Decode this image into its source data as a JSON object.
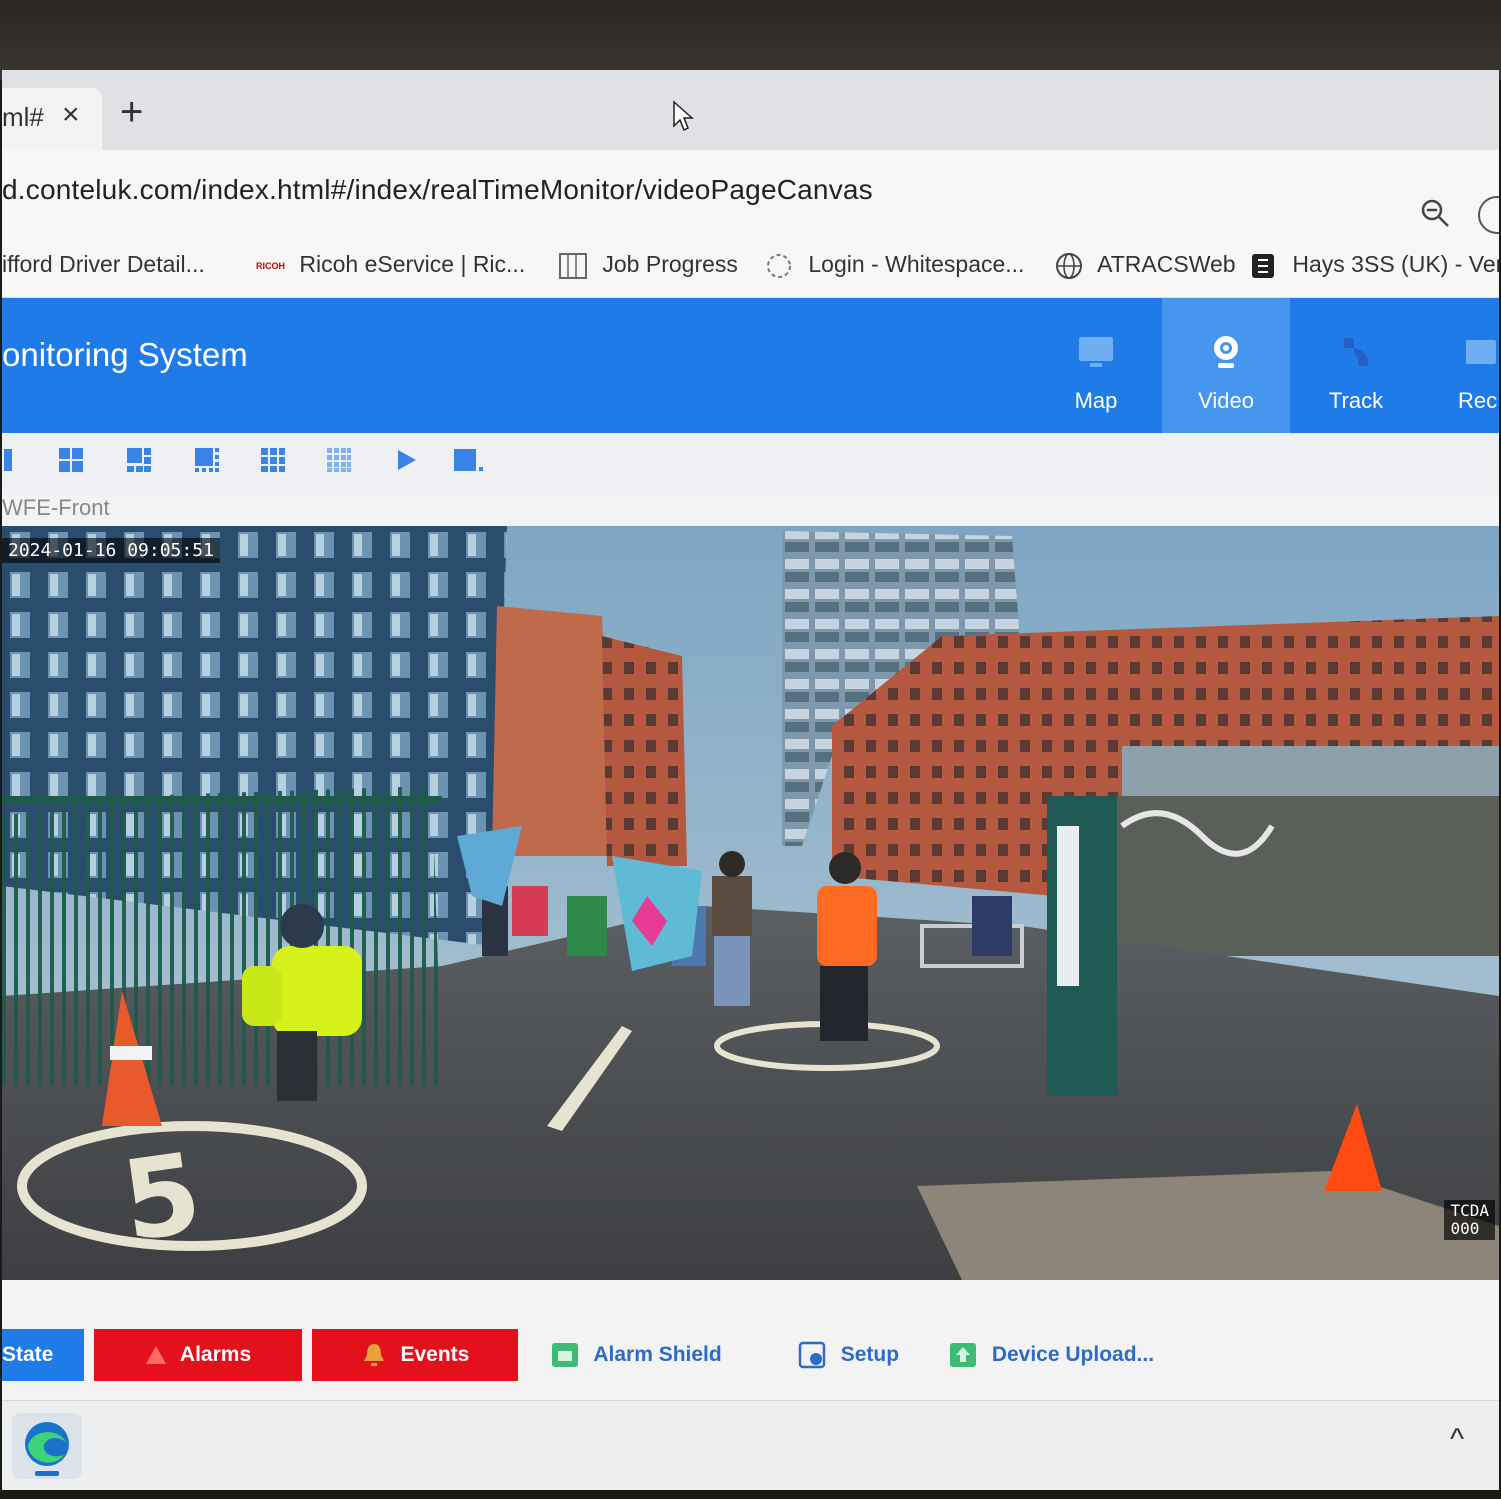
{
  "browser": {
    "tab_title": "ml#",
    "tab_close": "×",
    "new_tab": "+",
    "url": "d.conteluk.com/index.html#/index/realTimeMonitor/videoPageCanvas"
  },
  "bookmarks": [
    {
      "label": "ifford Driver Detail...",
      "icon": "none"
    },
    {
      "label": "Ricoh eService | Ric...",
      "icon": "ricoh-logo-icon",
      "logo_text": "RICOH"
    },
    {
      "label": "Job Progress",
      "icon": "table-icon"
    },
    {
      "label": "Login - Whitespace...",
      "icon": "ws-icon"
    },
    {
      "label": "ATRACSWeb",
      "icon": "globe-icon"
    },
    {
      "label": "Hays 3SS (UK) - Ven...",
      "icon": "hays-logo-icon"
    }
  ],
  "app": {
    "title": "onitoring System",
    "accent": "#1e7be8",
    "nav": [
      {
        "label": "Map",
        "icon": "monitor-icon",
        "active": false
      },
      {
        "label": "Video",
        "icon": "webcam-icon",
        "active": true
      },
      {
        "label": "Track",
        "icon": "track-icon",
        "active": false
      },
      {
        "label": "Rec",
        "icon": "record-icon",
        "active": false
      }
    ]
  },
  "toolbar": {
    "buttons": [
      "layout-1-icon",
      "layout-4-icon",
      "layout-6-icon",
      "layout-8-icon",
      "layout-9-icon",
      "layout-16-icon",
      "play-icon",
      "stop-icon"
    ]
  },
  "video": {
    "channel_label": "WFE-Front",
    "osd_timestamp": "2024-01-16 09:05:51",
    "osd_corner": "TCDA\n000"
  },
  "bottom_tabs": [
    {
      "label": "State",
      "style": "blue"
    },
    {
      "label": "Alarms",
      "style": "red",
      "icon": "warning-icon"
    },
    {
      "label": "Events",
      "style": "red",
      "icon": "bell-icon"
    },
    {
      "label": "Alarm Shield",
      "style": "plain",
      "icon": "shield-icon"
    },
    {
      "label": "Setup",
      "style": "plain",
      "icon": "setup-icon"
    },
    {
      "label": "Device Upload...",
      "style": "plain",
      "icon": "upload-icon"
    }
  ],
  "taskbar": {
    "chevron": "^"
  },
  "colors": {
    "alarm_red": "#e4111c",
    "nav_active": "#4596ef"
  }
}
